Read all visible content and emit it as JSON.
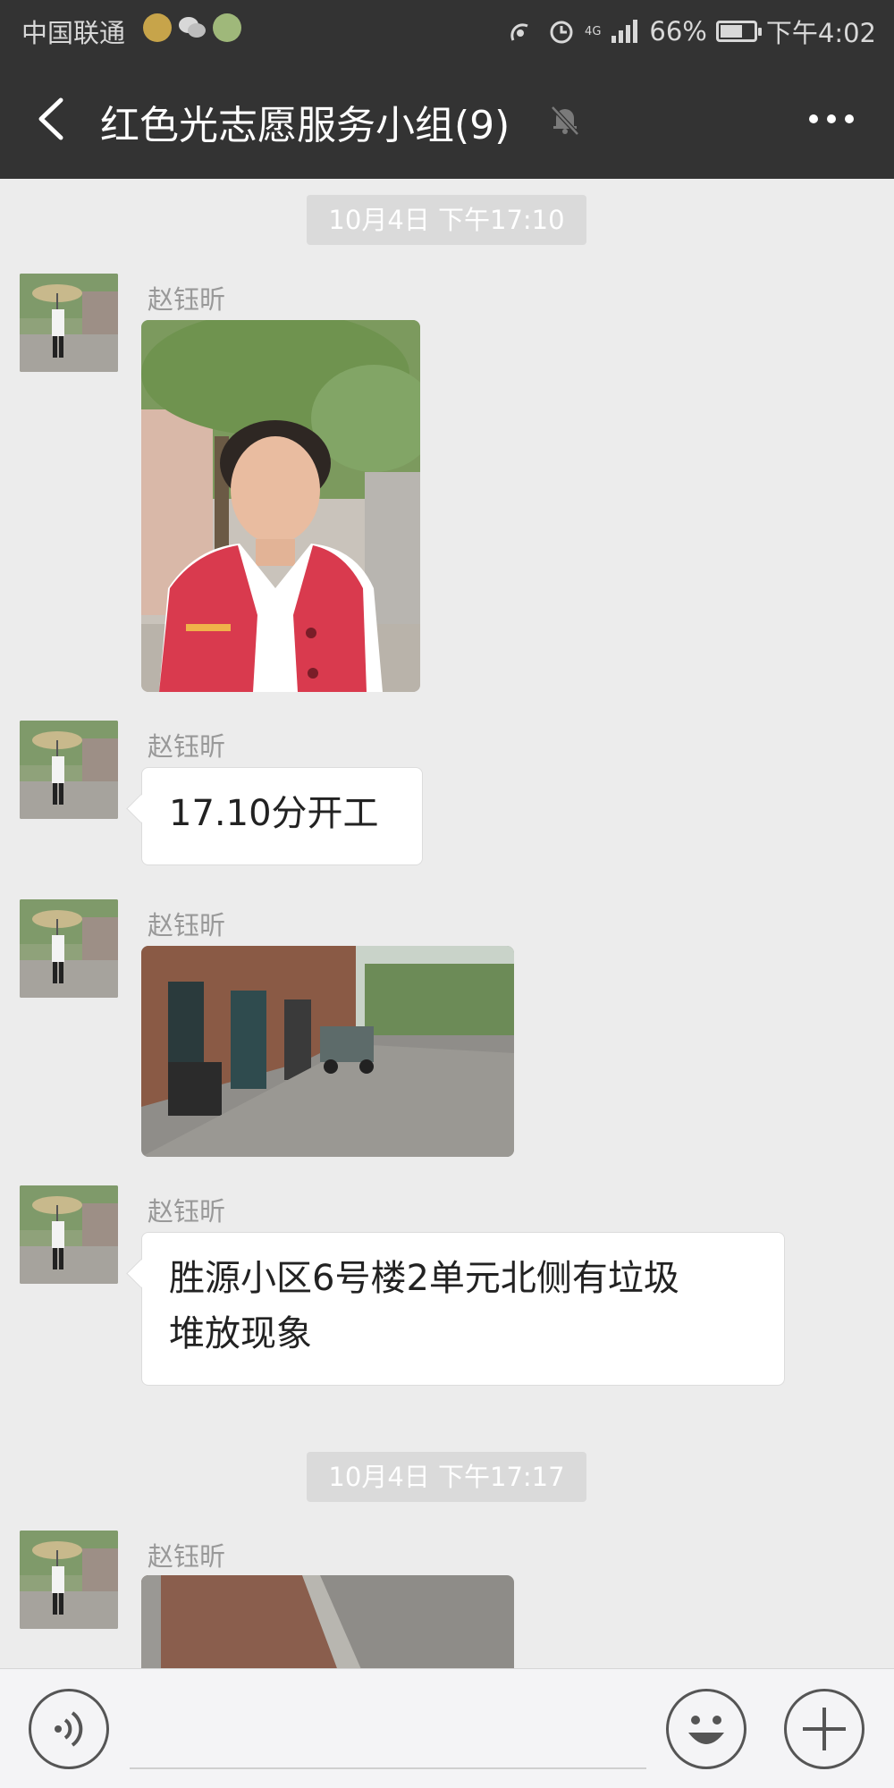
{
  "status_bar": {
    "carrier": "中国联通",
    "network": "4G",
    "battery": "66%",
    "battery_level": 0.66,
    "time": "下午4:02"
  },
  "header": {
    "title": "红色光志愿服务小组(9)",
    "back_icon": "chevron-left-icon",
    "mute_icon": "bell-off-icon",
    "more_icon": "more-dots-icon"
  },
  "messages": [
    {
      "type": "time",
      "text": "10月4日 下午17:10"
    },
    {
      "type": "image",
      "sender": "赵钰昕",
      "image": "photo of volunteer in red vest under a tree"
    },
    {
      "type": "text",
      "sender": "赵钰昕",
      "text": "17.10分开工"
    },
    {
      "type": "image",
      "sender": "赵钰昕",
      "image": "photo of paved lane beside apartment building"
    },
    {
      "type": "text",
      "sender": "赵钰昕",
      "lines": [
        "胜源小区6号楼2单元北侧有垃圾",
        "堆放现象"
      ]
    },
    {
      "type": "time",
      "text": "10月4日 下午17:17"
    },
    {
      "type": "image",
      "sender": "赵钰昕",
      "image": "photo of brick pavement and road"
    }
  ],
  "input_bar": {
    "voice_icon": "voice-icon",
    "emoji_icon": "emoji-icon",
    "plus_icon": "plus-icon"
  },
  "colors": {
    "header_bg": "#333333",
    "chat_bg": "#ececec",
    "bubble_bg": "#ffffff",
    "vest_red": "#d93a4e"
  }
}
